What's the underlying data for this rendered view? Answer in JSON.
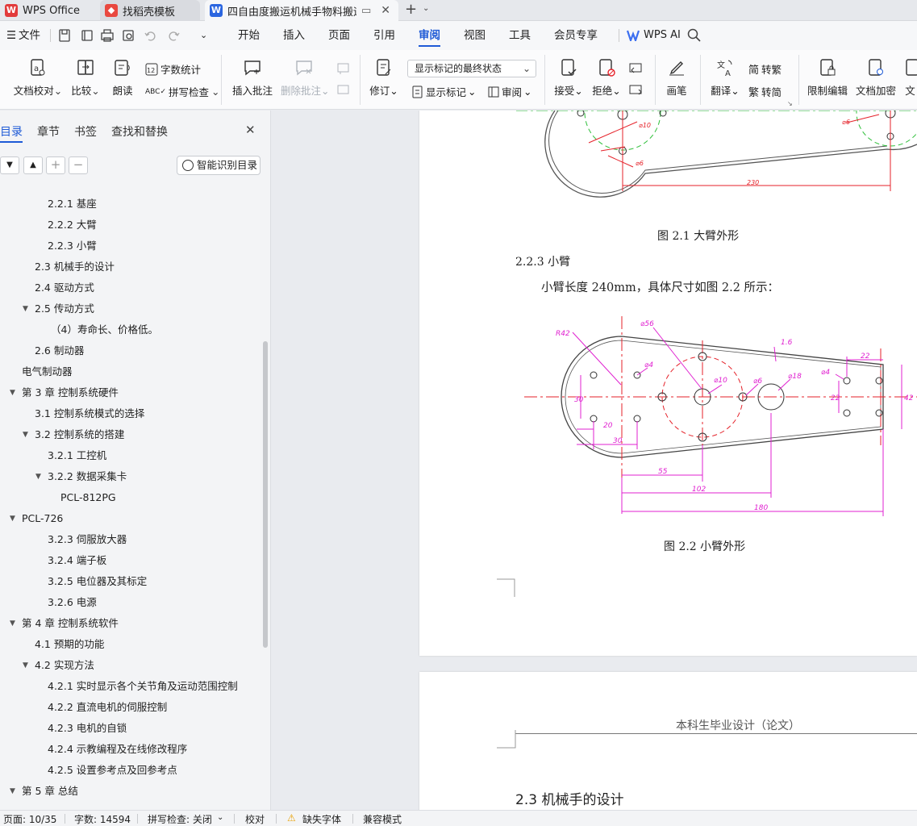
{
  "titlebar": {
    "tabs": [
      {
        "label": "WPS Office"
      },
      {
        "label": "找稻壳模板"
      },
      {
        "label": "四自由度搬运机械手物料搬运"
      }
    ],
    "new_tab_symbol": "+"
  },
  "menubar": {
    "file_label": "文件",
    "tabs": [
      "开始",
      "插入",
      "页面",
      "引用",
      "审阅",
      "视图",
      "工具",
      "会员专享"
    ],
    "active_tab": "审阅",
    "ai_label": "WPS AI"
  },
  "ribbon": {
    "doc_proof": "文档校对",
    "compare": "比较",
    "read_aloud": "朗读",
    "word_count": "字数统计",
    "spell_check": "拼写检查",
    "insert_comment": "插入批注",
    "delete_comment": "删除批注",
    "track_changes": "修订",
    "markup_select": "显示标记的最终状态",
    "show_markup": "显示标记",
    "review": "审阅",
    "accept": "接受",
    "reject": "拒绝",
    "pen": "画笔",
    "translate": "翻译",
    "to_traditional": "转繁",
    "to_simplified": "转简",
    "restrict_edit": "限制编辑",
    "encrypt": "文档加密",
    "doc_cut": "文"
  },
  "nav": {
    "tabs": [
      "目录",
      "章节",
      "书签",
      "查找和替换"
    ],
    "active_tab": "目录",
    "smart_toc": "智能识别目录",
    "toc": [
      {
        "label": "2.2.1  基座",
        "level": 3,
        "toggle": ""
      },
      {
        "label": "2.2.2  大臂",
        "level": 3,
        "toggle": ""
      },
      {
        "label": "2.2.3  小臂",
        "level": 3,
        "toggle": ""
      },
      {
        "label": "2.3 机械手的设计",
        "level": 2,
        "toggle": ""
      },
      {
        "label": "2.4 驱动方式",
        "level": 2,
        "toggle": ""
      },
      {
        "label": "2.5 传动方式",
        "level": 2,
        "toggle": "▼"
      },
      {
        "label": "（4）寿命长、价格低。",
        "level": 4,
        "toggle": ""
      },
      {
        "label": "2.6 制动器",
        "level": 2,
        "toggle": ""
      },
      {
        "label": "电气制动器",
        "level": 1,
        "toggle": ""
      },
      {
        "label": "第 3 章  控制系统硬件",
        "level": 1,
        "toggle": "▼"
      },
      {
        "label": "3.1  控制系统模式的选择",
        "level": 2,
        "toggle": ""
      },
      {
        "label": "3.2 控制系统的搭建",
        "level": 2,
        "toggle": "▼"
      },
      {
        "label": "3.2.1 工控机",
        "level": 3,
        "toggle": ""
      },
      {
        "label": "3.2.2 数据采集卡",
        "level": 3,
        "toggle": "▼"
      },
      {
        "label": "PCL-812PG",
        "level": 4,
        "toggle": ""
      },
      {
        "label": "PCL-726",
        "level": 1,
        "toggle": "▼"
      },
      {
        "label": "3.2.3 伺服放大器",
        "level": 3,
        "toggle": ""
      },
      {
        "label": "3.2.4 端子板",
        "level": 3,
        "toggle": ""
      },
      {
        "label": "3.2.5 电位器及其标定",
        "level": 3,
        "toggle": ""
      },
      {
        "label": "3.2.6 电源",
        "level": 3,
        "toggle": ""
      },
      {
        "label": "第 4 章  控制系统软件",
        "level": 1,
        "toggle": "▼"
      },
      {
        "label": "4.1 预期的功能",
        "level": 2,
        "toggle": ""
      },
      {
        "label": "4.2  实现方法",
        "level": 2,
        "toggle": "▼"
      },
      {
        "label": "4.2.1 实时显示各个关节角及运动范围控制",
        "level": 3,
        "toggle": ""
      },
      {
        "label": "4.2.2 直流电机的伺服控制",
        "level": 3,
        "toggle": ""
      },
      {
        "label": "4.2.3 电机的自锁",
        "level": 3,
        "toggle": ""
      },
      {
        "label": "4.2.4 示教编程及在线修改程序",
        "level": 3,
        "toggle": ""
      },
      {
        "label": "4.2.5 设置参考点及回参考点",
        "level": 3,
        "toggle": ""
      },
      {
        "label": "第 5 章  总结",
        "level": 1,
        "toggle": "▼"
      }
    ]
  },
  "document": {
    "fig1_dim": "230",
    "fig1_labels": [
      "⌀10",
      "⌀6",
      "⌀6"
    ],
    "fig1_caption": "图 2.1  大臂外形",
    "heading_223": "2.2.3  小臂",
    "paragraph": "小臂长度 240mm，具体尺寸如图 2.2 所示：",
    "fig2_labels": {
      "r42": "R42",
      "d56": "⌀56",
      "d4a": "⌀4",
      "d10": "⌀10",
      "d6": "⌀6",
      "d18": "⌀18",
      "d4b": "⌀4",
      "t16": "1.6",
      "w22": "22",
      "h30": "30",
      "h22": "22",
      "h42": "42",
      "w20": "20",
      "w30": "30",
      "w55": "55",
      "w102": "102",
      "w180": "180"
    },
    "fig2_caption": "图 2.2  小臂外形",
    "header_text": "本科生毕业设计（论文）",
    "heading_23": "2.3 机械手的设计"
  },
  "status": {
    "page": "页面: 10/35",
    "words": "字数: 14594",
    "spell": "拼写检查: 关闭",
    "proof": "校对",
    "missing_font": "缺失字体",
    "compat": "兼容模式"
  },
  "colors": {
    "accent": "#1e5ad6",
    "cad_green": "#2fbf3a",
    "cad_red": "#e5222a",
    "cad_magenta": "#e020d0"
  }
}
